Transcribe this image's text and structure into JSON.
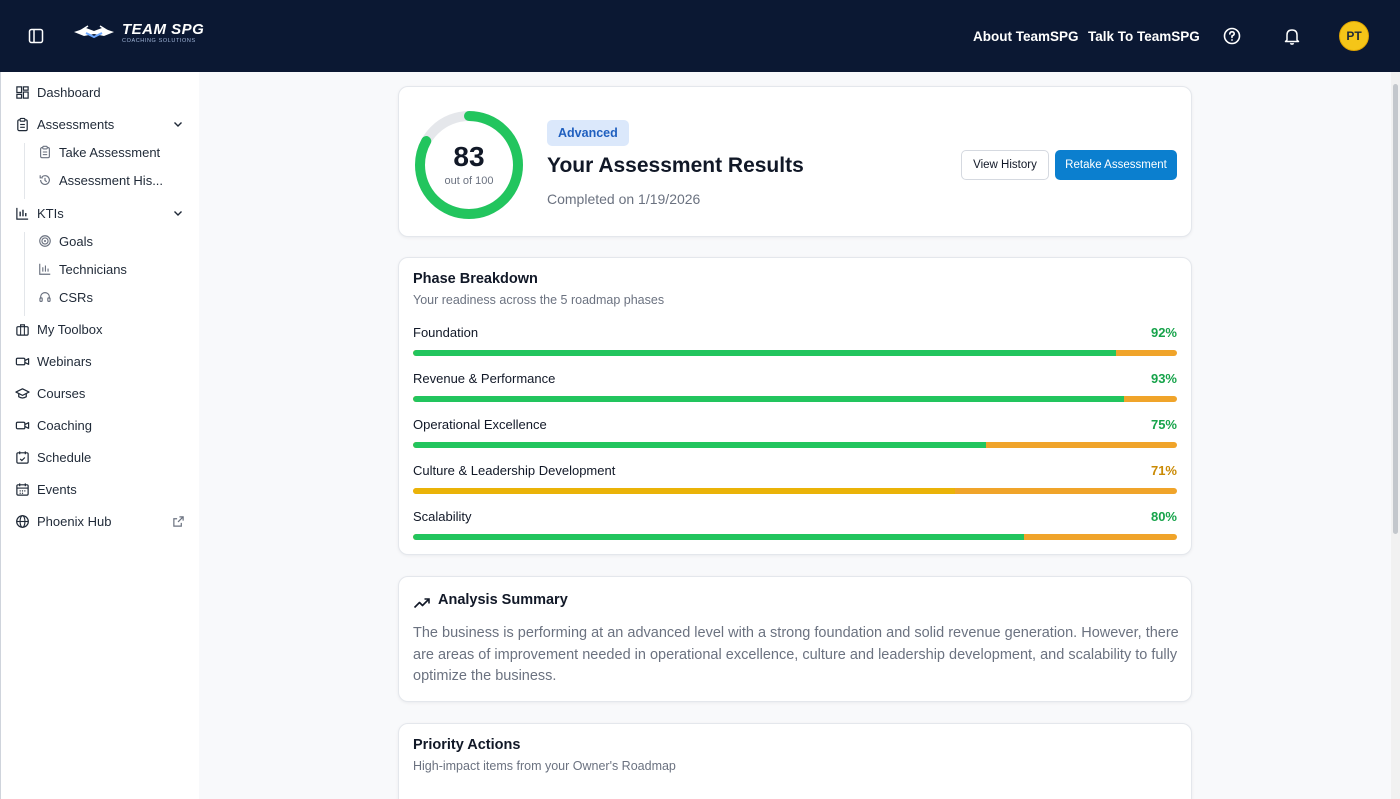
{
  "header": {
    "brand_main": "TEAM SPG",
    "brand_sub": "COACHING SOLUTIONS",
    "nav": {
      "about": "About TeamSPG",
      "talk": "Talk To TeamSPG"
    },
    "avatar_initials": "PT",
    "icons": [
      "sidebar-toggle-icon",
      "help-icon",
      "bell-icon"
    ]
  },
  "sidebar": {
    "items": [
      {
        "label": "Dashboard",
        "icon": "grid-icon"
      },
      {
        "label": "Assessments",
        "icon": "clipboard-icon",
        "expanded": true
      },
      {
        "label": "Take Assessment",
        "icon": "clipboard-icon"
      },
      {
        "label": "Assessment His...",
        "icon": "history-icon"
      },
      {
        "label": "KTIs",
        "icon": "bar-chart-icon",
        "expanded": true
      },
      {
        "label": "Goals",
        "icon": "target-icon"
      },
      {
        "label": "Technicians",
        "icon": "bar-chart-icon"
      },
      {
        "label": "CSRs",
        "icon": "headset-icon"
      },
      {
        "label": "My Toolbox",
        "icon": "briefcase-icon"
      },
      {
        "label": "Webinars",
        "icon": "video-icon"
      },
      {
        "label": "Courses",
        "icon": "graduation-cap-icon"
      },
      {
        "label": "Coaching",
        "icon": "video-icon"
      },
      {
        "label": "Schedule",
        "icon": "calendar-check-icon"
      },
      {
        "label": "Events",
        "icon": "calendar-icon"
      },
      {
        "label": "Phoenix Hub",
        "icon": "globe-icon"
      }
    ]
  },
  "score": {
    "value": "83",
    "out_of": "out of 100",
    "fraction": 0.83,
    "badge": "Advanced",
    "title": "Your Assessment Results",
    "completed": "Completed on 1/19/2026",
    "view_history": "View History",
    "retake": "Retake Assessment"
  },
  "phases": {
    "title": "Phase Breakdown",
    "subtitle": "Your readiness across the 5 roadmap phases",
    "items": [
      {
        "name": "Foundation",
        "pct": "92%",
        "value": 92,
        "color": "#22c55e"
      },
      {
        "name": "Revenue & Performance",
        "pct": "93%",
        "value": 93,
        "color": "#22c55e"
      },
      {
        "name": "Operational Excellence",
        "pct": "75%",
        "value": 75,
        "color": "#22c55e"
      },
      {
        "name": "Culture & Leadership Development",
        "pct": "71%",
        "value": 71,
        "color": "#eab308"
      },
      {
        "name": "Scalability",
        "pct": "80%",
        "value": 80,
        "color": "#22c55e"
      }
    ]
  },
  "analysis": {
    "title": "Analysis Summary",
    "text": "The business is performing at an advanced level with a strong foundation and solid revenue generation. However, there are areas of improvement needed in operational excellence, culture and leadership development, and scalability to fully optimize the business."
  },
  "priority": {
    "title": "Priority Actions",
    "subtitle": "High-impact items from your Owner's Roadmap"
  },
  "colors": {
    "header_bg": "#0b1833",
    "primary_button": "#0b7fcf",
    "ring": "#22c55e",
    "bar_remaining": "#f0a42a",
    "badge_bg": "#dbe8fb"
  }
}
